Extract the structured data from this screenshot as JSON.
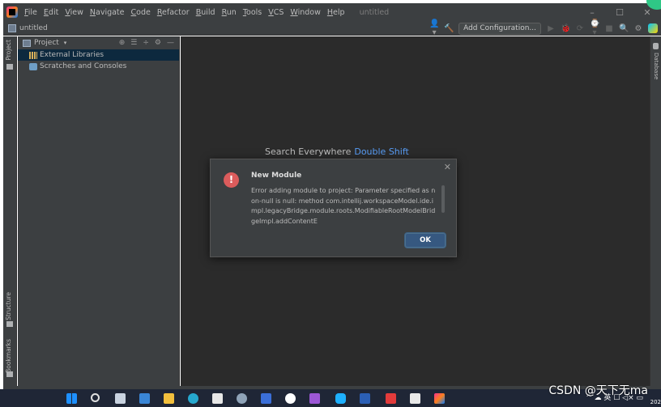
{
  "window": {
    "menu_items": [
      "File",
      "Edit",
      "View",
      "Navigate",
      "Code",
      "Refactor",
      "Build",
      "Run",
      "Tools",
      "VCS",
      "Window",
      "Help"
    ],
    "title": "untitled",
    "minimize_glyph": "–",
    "maximize_glyph": "☐",
    "close_glyph": "✕"
  },
  "toolbar": {
    "project_name": "untitled",
    "add_configuration_label": "Add Configuration...",
    "user_glyph": "👤▾",
    "build_glyph": "🔨",
    "run_glyph": "▶",
    "debug_glyph": "🐞",
    "coverage_glyph": "⟳",
    "profile_glyph": "⌚▾",
    "stop_glyph": "■",
    "search_glyph": "🔍",
    "settings_glyph": "⚙"
  },
  "left_strip": {
    "project_tab": "Project",
    "structure_tab": "Structure",
    "bookmarks_tab": "Bookmarks"
  },
  "right_strip": {
    "database_tab": "Database"
  },
  "project_panel": {
    "header_label": "Project",
    "chevron": "▾",
    "tools": [
      "⊕",
      "☰",
      "÷",
      "⚙",
      "—"
    ],
    "tree": [
      {
        "label": "External Libraries",
        "icon": "library-icon",
        "selected": true
      },
      {
        "label": "Scratches and Consoles",
        "icon": "scratches-icon",
        "selected": false
      }
    ]
  },
  "editor": {
    "hint_text": "Search Everywhere",
    "hint_shortcut": "Double Shift"
  },
  "dialog": {
    "title": "New Module",
    "message": "Error adding module to project: Parameter specified as non-null is null: method com.intellij.workspaceModel.ide.impl.legacyBridge.module.roots.ModifiableRootModelBridgeImpl.addContentE",
    "ok_label": "OK",
    "close_glyph": "✕",
    "error_glyph": "!"
  },
  "taskbar": {
    "watermark": "CSDN @天下无ma",
    "tray_text": "^ ☁ 英 ☐ ◁× ▭",
    "clock_fragment": "202"
  },
  "colors": {
    "ide_chrome": "#3c3f41",
    "editor_bg": "#2b2b2b",
    "selection": "#0d293e",
    "accent_link": "#589df6",
    "ok_button": "#365880",
    "error_red": "#db5c5c",
    "taskbar": "#1f2636"
  }
}
